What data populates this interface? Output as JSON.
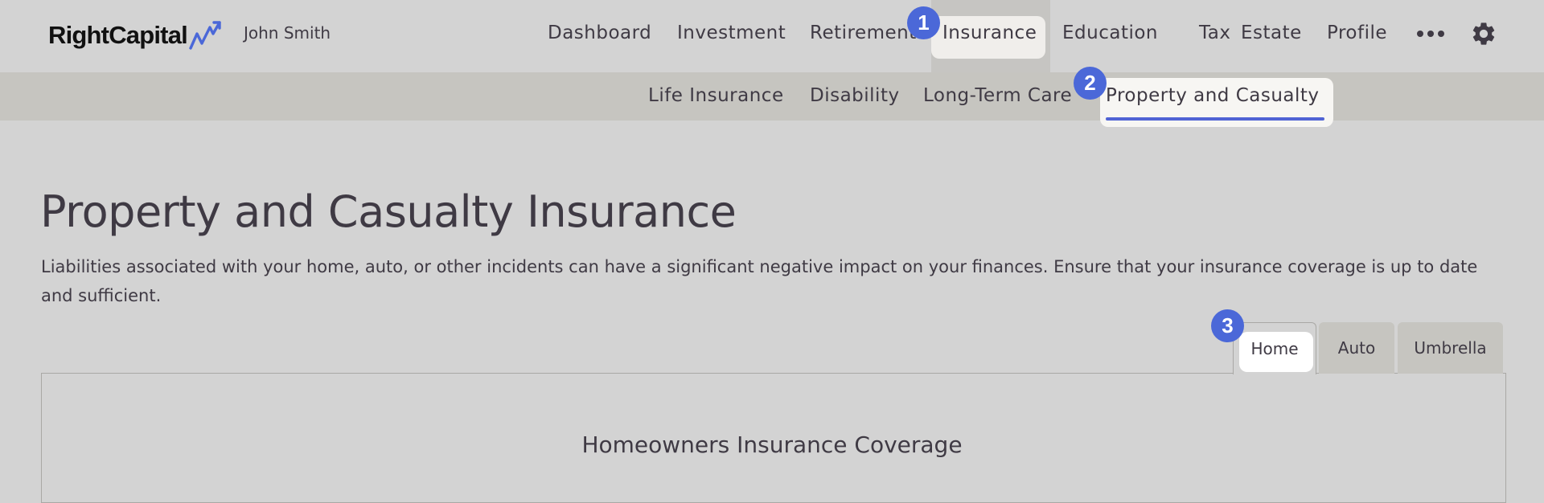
{
  "app": {
    "logo_text": "RightCapital",
    "user_name": "John Smith"
  },
  "nav": {
    "items": [
      "Dashboard",
      "Investment",
      "Retirement",
      "Insurance",
      "Education",
      "Tax",
      "Estate",
      "Profile"
    ],
    "active": "Insurance",
    "more_icon": "more-dots-icon",
    "settings_icon": "gear-icon"
  },
  "subnav": {
    "items": [
      "Life Insurance",
      "Disability",
      "Long-Term Care",
      "Property and Casualty"
    ],
    "active": "Property and Casualty",
    "underline_color": "#5063d4"
  },
  "badges": [
    "1",
    "2",
    "3"
  ],
  "page": {
    "title": "Property and Casualty Insurance",
    "description": "Liabilities associated with your home, auto, or other incidents can have a significant negative impact on your finances. Ensure that your insurance coverage is up to date and sufficient."
  },
  "tabs": {
    "items": [
      "Home",
      "Auto",
      "Umbrella"
    ],
    "active": "Home"
  },
  "section": {
    "title": "Homeowners Insurance Coverage"
  },
  "colors": {
    "accent": "#4b68d8",
    "background": "#d3d3d3",
    "subbar": "#c6c5c0",
    "text": "#3f3a44"
  }
}
